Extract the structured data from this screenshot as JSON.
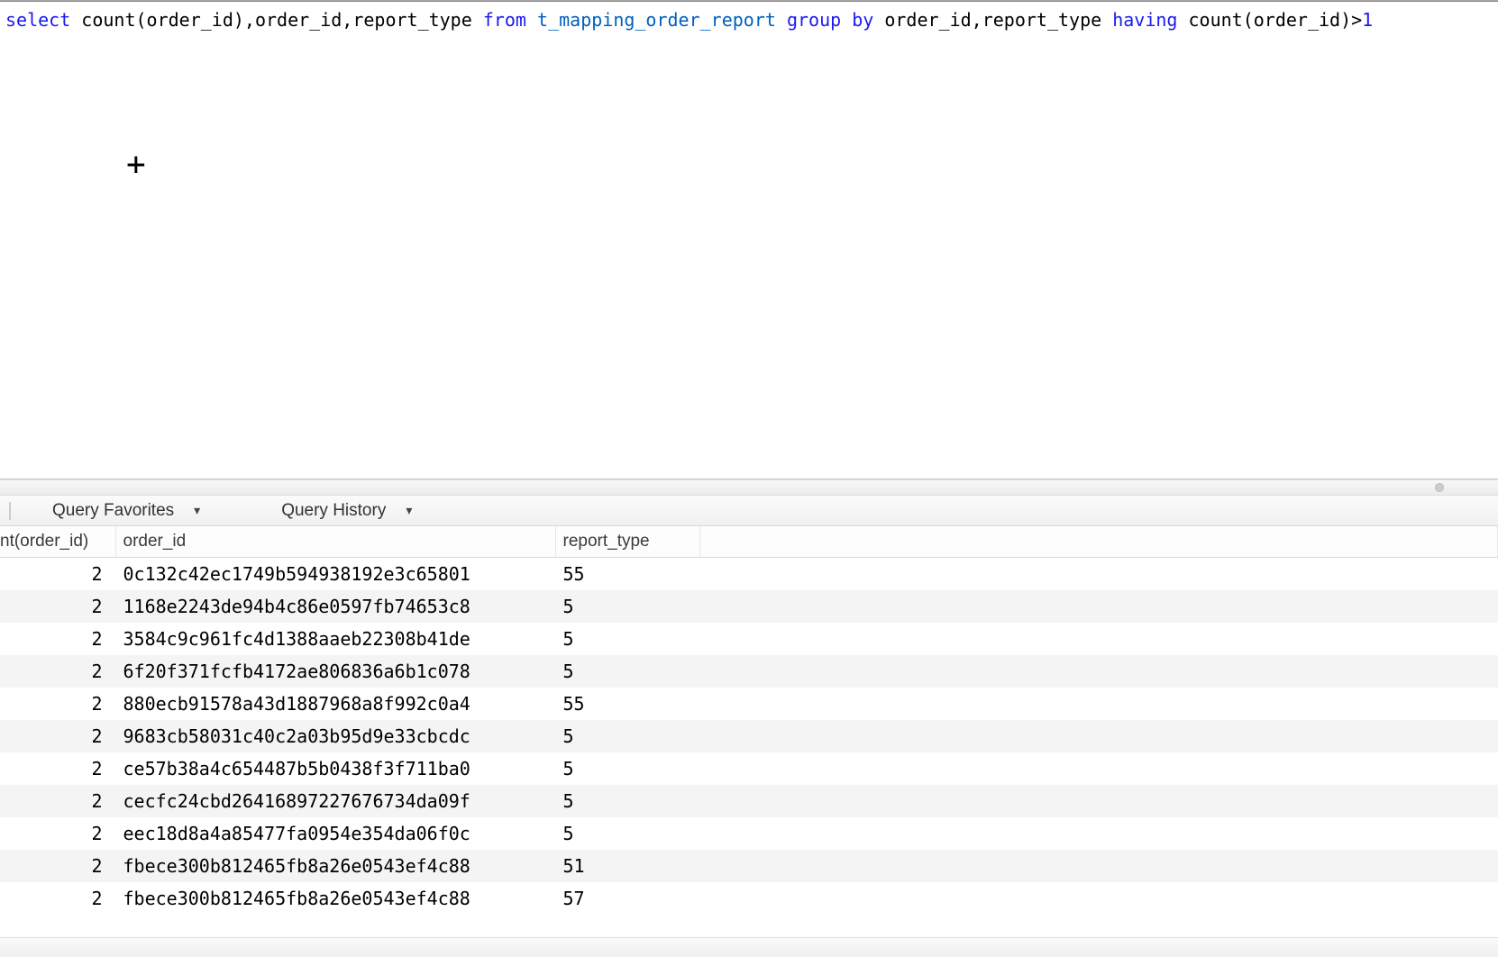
{
  "sql": {
    "select": "select",
    "expr": " count(order_id),order_id,report_type ",
    "from": "from",
    "table": " t_mapping_order_report ",
    "groupby": "group by",
    "groupcols": " order_id,report_type ",
    "having": "having",
    "havingexpr": " count(order_id)>",
    "num": "1"
  },
  "querybar": {
    "favorites": "Query Favorites",
    "history": "Query History"
  },
  "columns": {
    "count": "nt(order_id)",
    "order_id": "order_id",
    "report_type": "report_type"
  },
  "rows": [
    {
      "count": "2",
      "order_id": "0c132c42ec1749b594938192e3c65801",
      "report_type": "55"
    },
    {
      "count": "2",
      "order_id": "1168e2243de94b4c86e0597fb74653c8",
      "report_type": "5"
    },
    {
      "count": "2",
      "order_id": "3584c9c961fc4d1388aaeb22308b41de",
      "report_type": "5"
    },
    {
      "count": "2",
      "order_id": "6f20f371fcfb4172ae806836a6b1c078",
      "report_type": "5"
    },
    {
      "count": "2",
      "order_id": "880ecb91578a43d1887968a8f992c0a4",
      "report_type": "55"
    },
    {
      "count": "2",
      "order_id": "9683cb58031c40c2a03b95d9e33cbcdc",
      "report_type": "5"
    },
    {
      "count": "2",
      "order_id": "ce57b38a4c654487b5b0438f3f711ba0",
      "report_type": "5"
    },
    {
      "count": "2",
      "order_id": "cecfc24cbd26416897227676734da09f",
      "report_type": "5"
    },
    {
      "count": "2",
      "order_id": "eec18d8a4a85477fa0954e354da06f0c",
      "report_type": "5"
    },
    {
      "count": "2",
      "order_id": "fbece300b812465fb8a26e0543ef4c88",
      "report_type": "51"
    },
    {
      "count": "2",
      "order_id": "fbece300b812465fb8a26e0543ef4c88",
      "report_type": "57"
    }
  ]
}
